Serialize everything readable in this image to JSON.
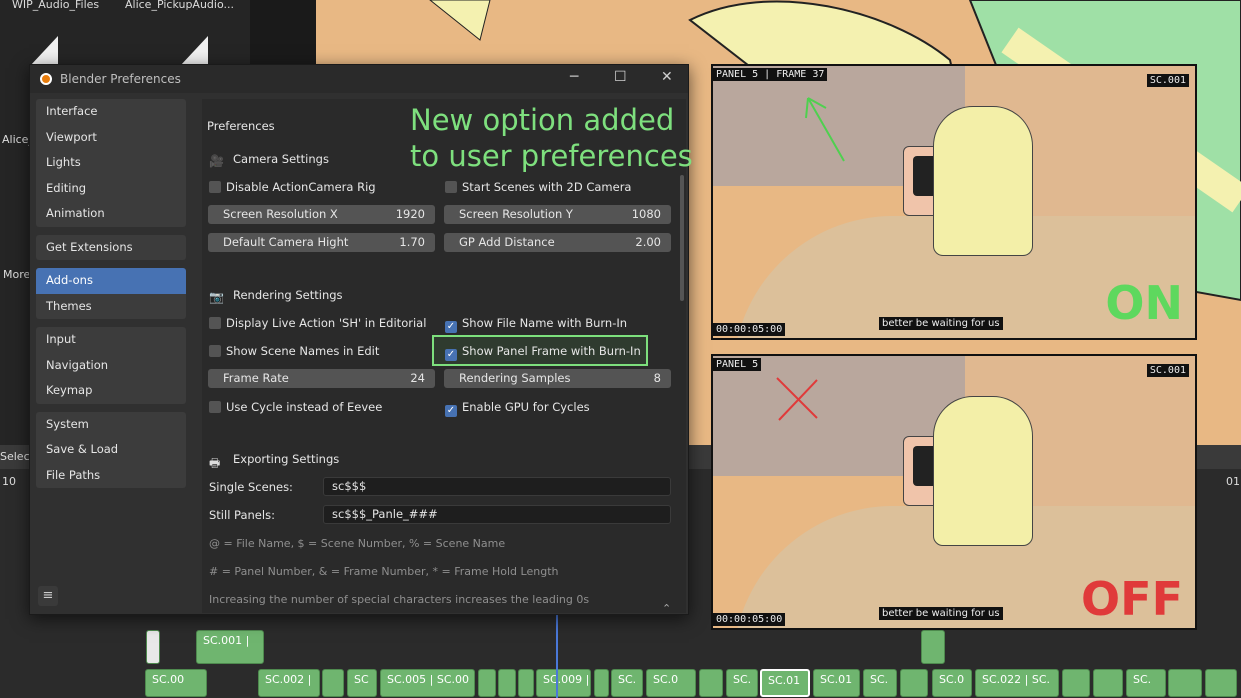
{
  "background": {
    "files": [
      "WIP_Audio_Files",
      "Alice_PickupAudio..."
    ],
    "side_labels": [
      "Alice_",
      "More"
    ],
    "timeline_left_label": "Select",
    "timeline_ticks": [
      "10",
      "01"
    ],
    "strips_row1": [
      "SC.001 |"
    ],
    "strips_row2": [
      "SC.00",
      "SC.002 |",
      "SC",
      "SC.005 | SC.00",
      "SC.009 |",
      "SC.",
      "SC.0",
      "SC.",
      "SC.01",
      "SC.01",
      "SC.",
      "SC.0",
      "SC.022 | SC.",
      "SC."
    ]
  },
  "window": {
    "title": "Blender Preferences",
    "minimize": "─",
    "maximize": "☐",
    "close": "✕"
  },
  "nav": {
    "groups": [
      [
        "Interface",
        "Viewport",
        "Lights",
        "Editing",
        "Animation"
      ],
      [
        "Get Extensions"
      ],
      [
        "Add-ons",
        "Themes"
      ],
      [
        "Input",
        "Navigation",
        "Keymap"
      ],
      [
        "System",
        "Save & Load",
        "File Paths"
      ]
    ],
    "active": "Add-ons",
    "menu_icon": "≡"
  },
  "content": {
    "header": "Preferences",
    "camera": {
      "title": "Camera Settings",
      "disable_rig": "Disable ActionCamera Rig",
      "start_2d": "Start Scenes with 2D Camera",
      "res_x_label": "Screen Resolution X",
      "res_x": "1920",
      "res_y_label": "Screen Resolution Y",
      "res_y": "1080",
      "cam_height_label": "Default Camera Hight",
      "cam_height": "1.70",
      "gp_dist_label": "GP Add Distance",
      "gp_dist": "2.00"
    },
    "rendering": {
      "title": "Rendering Settings",
      "live_action": "Display Live Action 'SH' in Editorial",
      "file_name": "Show File Name with Burn-In",
      "scene_names": "Show Scene Names in Edit",
      "panel_frame": "Show Panel Frame with Burn-In",
      "frame_rate_label": "Frame Rate",
      "frame_rate": "24",
      "samples_label": "Rendering Samples",
      "samples": "8",
      "use_cycle": "Use Cycle instead of Eevee",
      "gpu": "Enable GPU for Cycles"
    },
    "exporting": {
      "title": "Exporting Settings",
      "single_label": "Single Scenes:",
      "single_value": "sc$$$",
      "still_label": "Still Panels:",
      "still_value": "sc$$$_Panle_###",
      "hint1": "@ = File Name,  $ = Scene Number,  % = Scene Name",
      "hint2": "# = Panel Number,  & = Frame Number,  * = Frame Hold Length",
      "hint3": "Increasing the number of special characters increases the leading 0s"
    },
    "checks": {
      "disable_rig": false,
      "start_2d": false,
      "live_action": false,
      "file_name": true,
      "scene_names": false,
      "panel_frame": true,
      "use_cycle": false,
      "gpu": true
    }
  },
  "annotation": {
    "line1": "New option added",
    "line2": "to user preferences",
    "color": "#7ee07e"
  },
  "preview_on": {
    "panel_label": "PANEL 5 | FRAME 37",
    "scene": "SC.001",
    "timecode": "00:00:05:00",
    "subtitle": "better be waiting for us",
    "status": "ON",
    "status_color": "#5ed85e"
  },
  "preview_off": {
    "panel_label": "PANEL 5",
    "scene": "SC.001",
    "timecode": "00:00:05:00",
    "subtitle": "better be waiting for us",
    "status": "OFF",
    "status_color": "#e03a3a"
  },
  "colors": {
    "accent": "#4772b3",
    "highlight": "#7de07d",
    "strip": "#6fb56f"
  }
}
